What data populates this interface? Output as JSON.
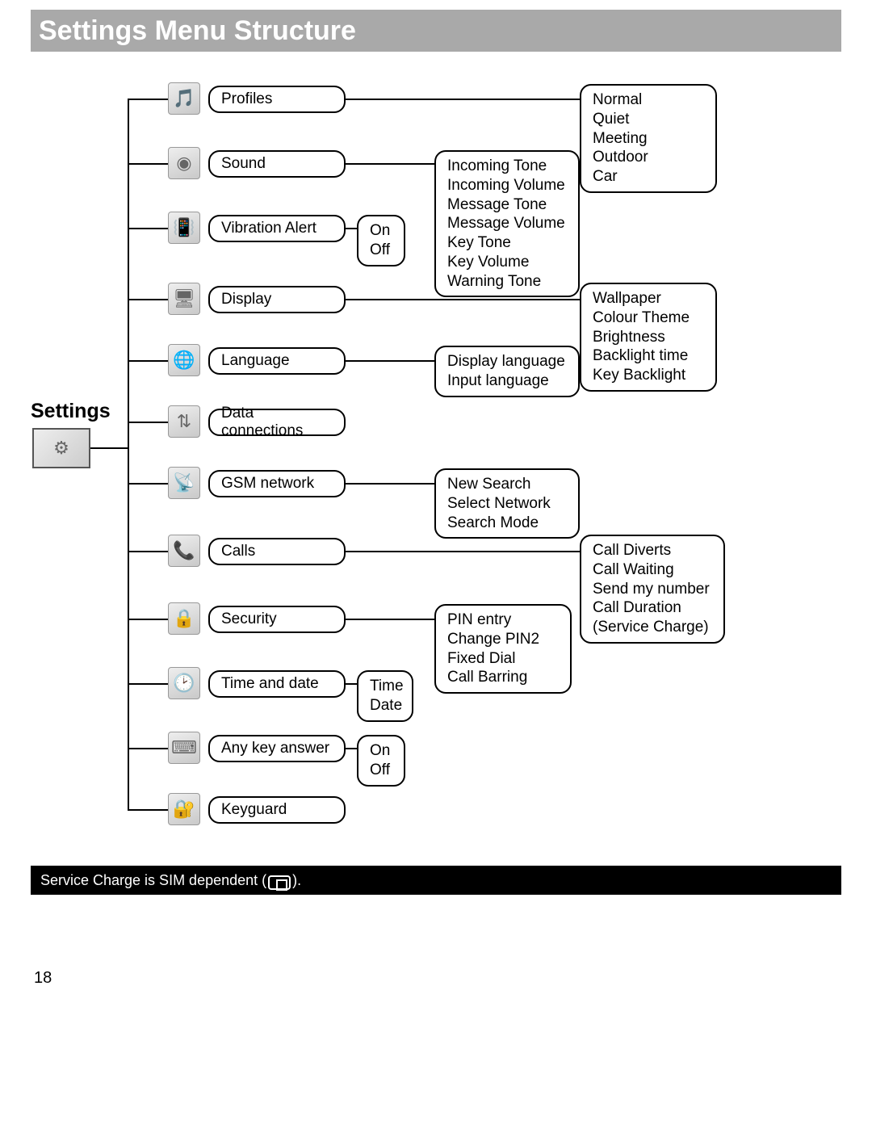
{
  "title": "Settings Menu Structure",
  "root_label": "Settings",
  "page_number": "18",
  "footer_note_prefix": "Service Charge is SIM dependent (",
  "footer_note_suffix": ").",
  "menu": {
    "profiles": {
      "label": "Profiles",
      "options": [
        "Normal",
        "Quiet",
        "Meeting",
        "Outdoor",
        "Car"
      ]
    },
    "sound": {
      "label": "Sound",
      "options": [
        "Incoming Tone",
        "Incoming Volume",
        "Message Tone",
        "Message Volume",
        "Key Tone",
        "Key Volume",
        "Warning Tone"
      ]
    },
    "vibration": {
      "label": "Vibration Alert",
      "options": [
        "On",
        "Off"
      ]
    },
    "display": {
      "label": "Display",
      "options": [
        "Wallpaper",
        "Colour Theme",
        "Brightness",
        "Backlight time",
        "Key Backlight"
      ]
    },
    "language": {
      "label": "Language",
      "options": [
        "Display language",
        "Input language"
      ]
    },
    "data_connections": {
      "label": "Data connections"
    },
    "gsm_network": {
      "label": "GSM network",
      "options": [
        "New Search",
        "Select Network",
        "Search Mode"
      ]
    },
    "calls": {
      "label": "Calls",
      "options": [
        "Call Diverts",
        "Call Waiting",
        "Send my number",
        "Call Duration",
        "(Service Charge)"
      ]
    },
    "security": {
      "label": "Security",
      "options": [
        "PIN entry",
        "Change PIN2",
        "Fixed Dial",
        "Call Barring"
      ]
    },
    "time_date": {
      "label": "Time and date",
      "options": [
        "Time",
        "Date"
      ]
    },
    "any_key": {
      "label": "Any key answer",
      "options": [
        "On",
        "Off"
      ]
    },
    "keyguard": {
      "label": "Keyguard"
    }
  }
}
